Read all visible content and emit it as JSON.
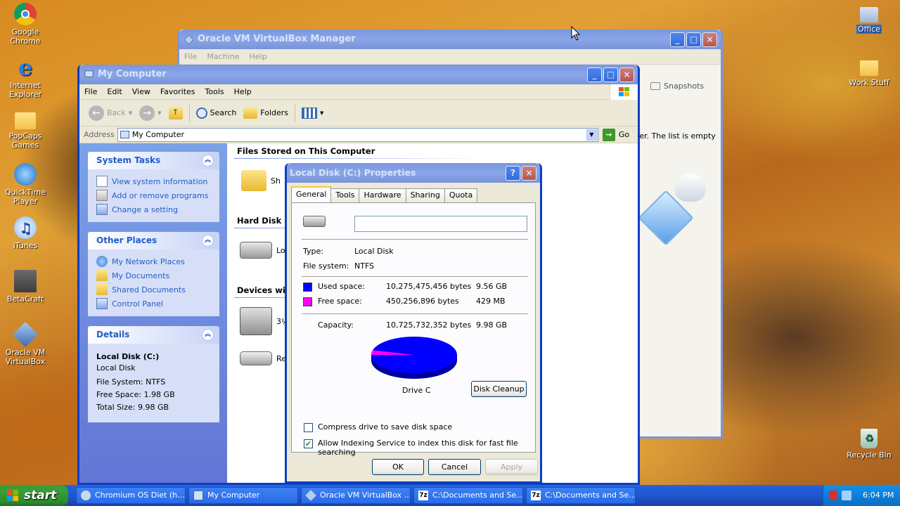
{
  "desktop": {
    "icons": [
      {
        "label": "Google Chrome"
      },
      {
        "label": "Internet Explorer"
      },
      {
        "label": "PopCaps Games"
      },
      {
        "label": "QuickTime Player"
      },
      {
        "label": "iTunes"
      },
      {
        "label": "BetaCraft"
      },
      {
        "label": "Oracle VM VirtualBox"
      },
      {
        "label": "Office"
      },
      {
        "label": "Work Stuff"
      },
      {
        "label": "Recycle Bin"
      }
    ]
  },
  "vbox": {
    "title": "Oracle VM VirtualBox Manager",
    "menu": [
      "File",
      "Machine",
      "Help"
    ],
    "snapshots_label": "Snapshots",
    "empty_text": "ter. The list is empty"
  },
  "explorer": {
    "title": "My Computer",
    "menu": [
      "File",
      "Edit",
      "View",
      "Favorites",
      "Tools",
      "Help"
    ],
    "toolbar": {
      "back": "Back",
      "search": "Search",
      "folders": "Folders"
    },
    "address": {
      "label": "Address",
      "value": "My Computer",
      "go": "Go"
    },
    "system_tasks": {
      "title": "System Tasks",
      "items": [
        "View system information",
        "Add or remove programs",
        "Change a setting"
      ]
    },
    "other_places": {
      "title": "Other Places",
      "items": [
        "My Network Places",
        "My Documents",
        "Shared Documents",
        "Control Panel"
      ]
    },
    "details": {
      "title": "Details",
      "name": "Local Disk (C:)",
      "type": "Local Disk",
      "fs": "File System: NTFS",
      "free": "Free Space: 1.98 GB",
      "total": "Total Size: 9.98 GB"
    },
    "sections": {
      "files": "Files Stored on This Computer",
      "hdd": "Hard Disk Dr",
      "devices": "Devices with"
    },
    "items": {
      "shared": "Sh",
      "local": "Loc",
      "floppy": "3½",
      "removable": "Re"
    }
  },
  "dialog": {
    "title": "Local Disk (C:) Properties",
    "tabs": [
      "General",
      "Tools",
      "Hardware",
      "Sharing",
      "Quota"
    ],
    "label_value": "",
    "type_label": "Type:",
    "type_value": "Local Disk",
    "fs_label": "File system:",
    "fs_value": "NTFS",
    "used": {
      "label": "Used space:",
      "bytes": "10,275,475,456 bytes",
      "size": "9.56 GB",
      "color": "#0000ff",
      "bytes_value": 10275475456
    },
    "free": {
      "label": "Free space:",
      "bytes": "450,256,896 bytes",
      "size": "429 MB",
      "color": "#ff00ff",
      "bytes_value": 450256896
    },
    "capacity": {
      "label": "Capacity:",
      "bytes": "10,725,732,352 bytes",
      "size": "9.98 GB"
    },
    "drive_label": "Drive C",
    "cleanup": "Disk Cleanup",
    "compress": {
      "label": "Compress drive to save disk space",
      "checked": false
    },
    "indexing": {
      "label": "Allow Indexing Service to index this disk for fast file searching",
      "checked": true
    },
    "buttons": {
      "ok": "OK",
      "cancel": "Cancel",
      "apply": "Apply"
    }
  },
  "taskbar": {
    "start": "start",
    "tasks": [
      {
        "label": "Chromium OS Diet (h..."
      },
      {
        "label": "My Computer"
      },
      {
        "label": "Oracle VM VirtualBox ..."
      },
      {
        "label": "C:\\Documents and Se..."
      },
      {
        "label": "C:\\Documents and Se..."
      }
    ],
    "clock": "6:04 PM"
  }
}
